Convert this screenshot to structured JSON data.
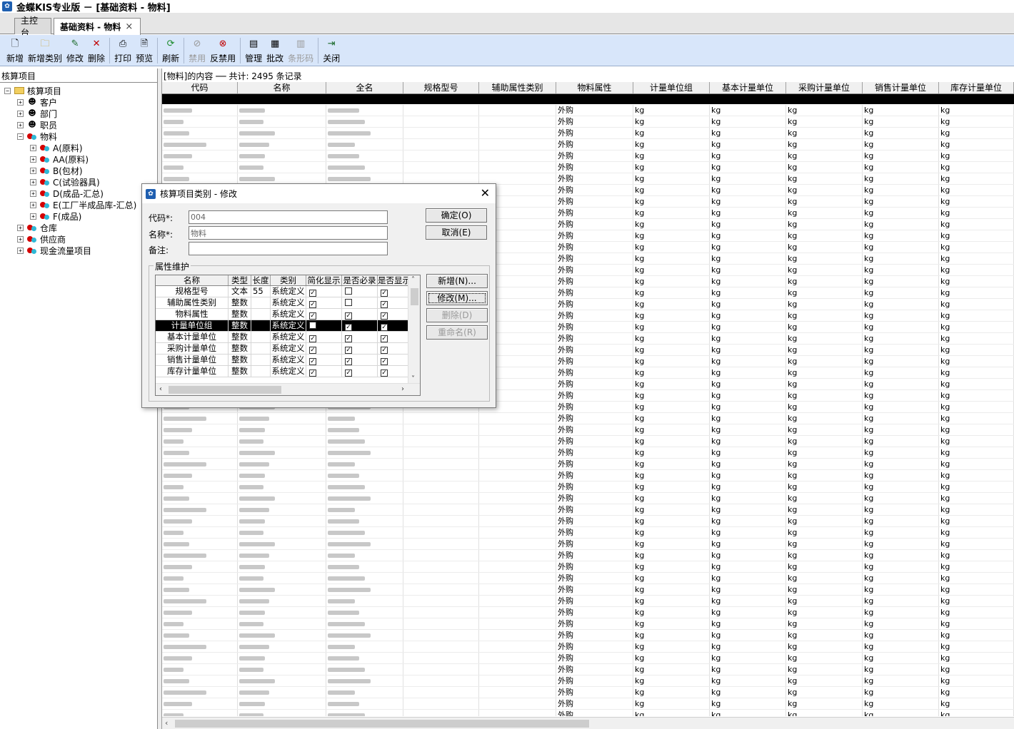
{
  "window": {
    "title": "金蝶KIS专业版 － [基础资料 - 物料]"
  },
  "tabs": [
    {
      "label": "主控台"
    },
    {
      "label": "基础资料 - 物料",
      "close": "×"
    }
  ],
  "toolbar": [
    {
      "label": "新增",
      "icon": "new-doc-icon"
    },
    {
      "label": "新增类别",
      "icon": "folder-icon"
    },
    {
      "label": "修改",
      "icon": "edit-icon"
    },
    {
      "label": "删除",
      "icon": "delete-icon"
    },
    {
      "label": "打印",
      "icon": "print-icon"
    },
    {
      "label": "预览",
      "icon": "preview-icon"
    },
    {
      "label": "刷新",
      "icon": "refresh-icon"
    },
    {
      "label": "禁用",
      "icon": "disable-icon",
      "disabled": true
    },
    {
      "label": "反禁用",
      "icon": "enable-icon"
    },
    {
      "label": "管理",
      "icon": "manage-icon"
    },
    {
      "label": "批改",
      "icon": "batch-edit-icon"
    },
    {
      "label": "条形码",
      "icon": "barcode-icon",
      "disabled": true
    },
    {
      "label": "关闭",
      "icon": "exit-icon"
    }
  ],
  "left_panel": {
    "header": "核算项目",
    "tree": [
      {
        "label": "核算项目",
        "level": 0,
        "exp": "−",
        "icon": "folder"
      },
      {
        "label": "客户",
        "level": 1,
        "exp": "+",
        "icon": "person"
      },
      {
        "label": "部门",
        "level": 1,
        "exp": "+",
        "icon": "person"
      },
      {
        "label": "职员",
        "level": 1,
        "exp": "+",
        "icon": "person"
      },
      {
        "label": "物料",
        "level": 1,
        "exp": "−",
        "icon": "ball"
      },
      {
        "label": "A(原料)",
        "level": 2,
        "exp": "+",
        "icon": "ball"
      },
      {
        "label": "AA(原料)",
        "level": 2,
        "exp": "+",
        "icon": "ball"
      },
      {
        "label": "B(包材)",
        "level": 2,
        "exp": "+",
        "icon": "ball"
      },
      {
        "label": "C(试验器具)",
        "level": 2,
        "exp": "+",
        "icon": "ball"
      },
      {
        "label": "D(成品-汇总)",
        "level": 2,
        "exp": "+",
        "icon": "ball"
      },
      {
        "label": "E(工厂半成品库-汇总)",
        "level": 2,
        "exp": "+",
        "icon": "ball"
      },
      {
        "label": "F(成品)",
        "level": 2,
        "exp": "+",
        "icon": "ball"
      },
      {
        "label": "仓库",
        "level": 1,
        "exp": "+",
        "icon": "ball"
      },
      {
        "label": "供应商",
        "level": 1,
        "exp": "+",
        "icon": "ball"
      },
      {
        "label": "现金流量项目",
        "level": 1,
        "exp": "+",
        "icon": "ball"
      }
    ]
  },
  "grid": {
    "info": "[物料]的内容 ── 共计: 2495 条记录",
    "columns": [
      "代码",
      "名称",
      "全名",
      "规格型号",
      "辅助属性类别",
      "物料属性",
      "计量单位组",
      "基本计量单位",
      "采购计量单位",
      "销售计量单位",
      "库存计量单位"
    ],
    "cell_attr": "外购",
    "cell_unit": "kg"
  },
  "dialog": {
    "title": "核算项目类别 - 修改",
    "close": "✕",
    "code_label": "代码*:",
    "code_value": "004",
    "name_label": "名称*:",
    "name_value": "物料",
    "note_label": "备注:",
    "note_value": "",
    "ok_button": "确定(O)",
    "cancel_button": "取消(E)",
    "group_label": "属性维护",
    "attr_columns": [
      "名称",
      "类型",
      "长度",
      "类别",
      "简化显示",
      "是否必录",
      "是否显示"
    ],
    "attr_rows": [
      {
        "name": "规格型号",
        "type": "文本",
        "len": "55",
        "cat": "系统定义",
        "simple": true,
        "required": false,
        "show": true
      },
      {
        "name": "辅助属性类别",
        "type": "整数",
        "len": "",
        "cat": "系统定义",
        "simple": true,
        "required": false,
        "show": true
      },
      {
        "name": "物料属性",
        "type": "整数",
        "len": "",
        "cat": "系统定义",
        "simple": true,
        "required": true,
        "show": true
      },
      {
        "name": "计量单位组",
        "type": "整数",
        "len": "",
        "cat": "系统定义",
        "simple": false,
        "required": true,
        "show": true,
        "selected": true
      },
      {
        "name": "基本计量单位",
        "type": "整数",
        "len": "",
        "cat": "系统定义",
        "simple": true,
        "required": true,
        "show": true
      },
      {
        "name": "采购计量单位",
        "type": "整数",
        "len": "",
        "cat": "系统定义",
        "simple": true,
        "required": true,
        "show": true
      },
      {
        "name": "销售计量单位",
        "type": "整数",
        "len": "",
        "cat": "系统定义",
        "simple": true,
        "required": true,
        "show": true
      },
      {
        "name": "库存计量单位",
        "type": "整数",
        "len": "",
        "cat": "系统定义",
        "simple": true,
        "required": true,
        "show": true
      }
    ],
    "add_button": "新增(N)...",
    "modify_button": "修改(M)...",
    "delete_button": "删除(D)",
    "rename_button": "重命名(R)"
  }
}
